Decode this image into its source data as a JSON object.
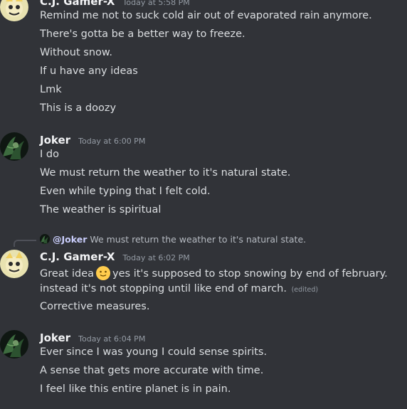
{
  "messages": [
    {
      "author": "C.J. Gamer-X",
      "timestamp": "Today at 5:58 PM",
      "lines": [
        "Remind me not to suck cold air out of evaporated rain anymore.",
        "There's gotta be a better way to freeze.",
        "Without snow.",
        "If u have any ideas",
        "Lmk",
        "This is a doozy"
      ]
    },
    {
      "author": "Joker",
      "timestamp": "Today at 6:00 PM",
      "lines": [
        "I do",
        "We must return the weather to it's natural state.",
        "Even while typing that I felt cold.",
        "The weather is spiritual"
      ]
    },
    {
      "reply": {
        "mention": "@Joker",
        "text": "We must return the weather to it's natural state."
      },
      "author": "C.J. Gamer-X",
      "timestamp": "Today at 6:02 PM",
      "line1_a": "Great idea",
      "line1_b": "yes it's supposed to stop snowing by end of february.",
      "line2": "instead it's not stopping until like end of march.",
      "edited": "(edited)",
      "line3": "Corrective measures."
    },
    {
      "author": "Joker",
      "timestamp": "Today at 6:04 PM",
      "lines": [
        "Ever since I was young I could sense spirits.",
        "A sense that gets more accurate with time.",
        "I feel like this entire planet is in pain."
      ]
    }
  ]
}
